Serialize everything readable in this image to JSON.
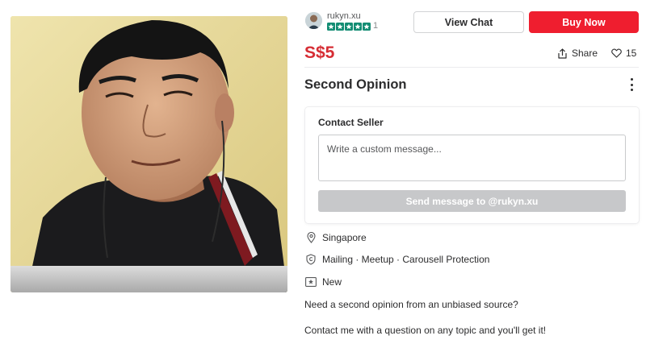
{
  "listing": {
    "photo_alt": "listing-photo",
    "seller": {
      "username": "rukyn.xu",
      "rating_stars": 5,
      "review_count": "1"
    },
    "actions": {
      "view_chat_label": "View Chat",
      "buy_now_label": "Buy Now"
    },
    "price": "S$5",
    "share_label": "Share",
    "like_count": "15",
    "title": "Second Opinion",
    "contact": {
      "heading": "Contact Seller",
      "message_placeholder": "Write a custom message...",
      "send_label": "Send message to @rukyn.xu"
    },
    "details": {
      "location": "Singapore",
      "deal_methods": "Mailing · Meetup · Carousell Protection",
      "condition": "New"
    },
    "description": [
      "Need a second opinion from an unbiased source?",
      "Contact me with a question on any topic and you'll get it!"
    ]
  },
  "colors": {
    "brand_red": "#ef1e2f",
    "price_red": "#d62d34",
    "star_green": "#148d74",
    "disabled_gray": "#c7c8ca"
  },
  "icons": {
    "share": "share-icon",
    "like": "heart-icon",
    "more": "more-vertical-icon",
    "location": "location-pin-icon",
    "deal": "shield-icon",
    "condition": "new-badge-icon",
    "star": "star-icon"
  }
}
